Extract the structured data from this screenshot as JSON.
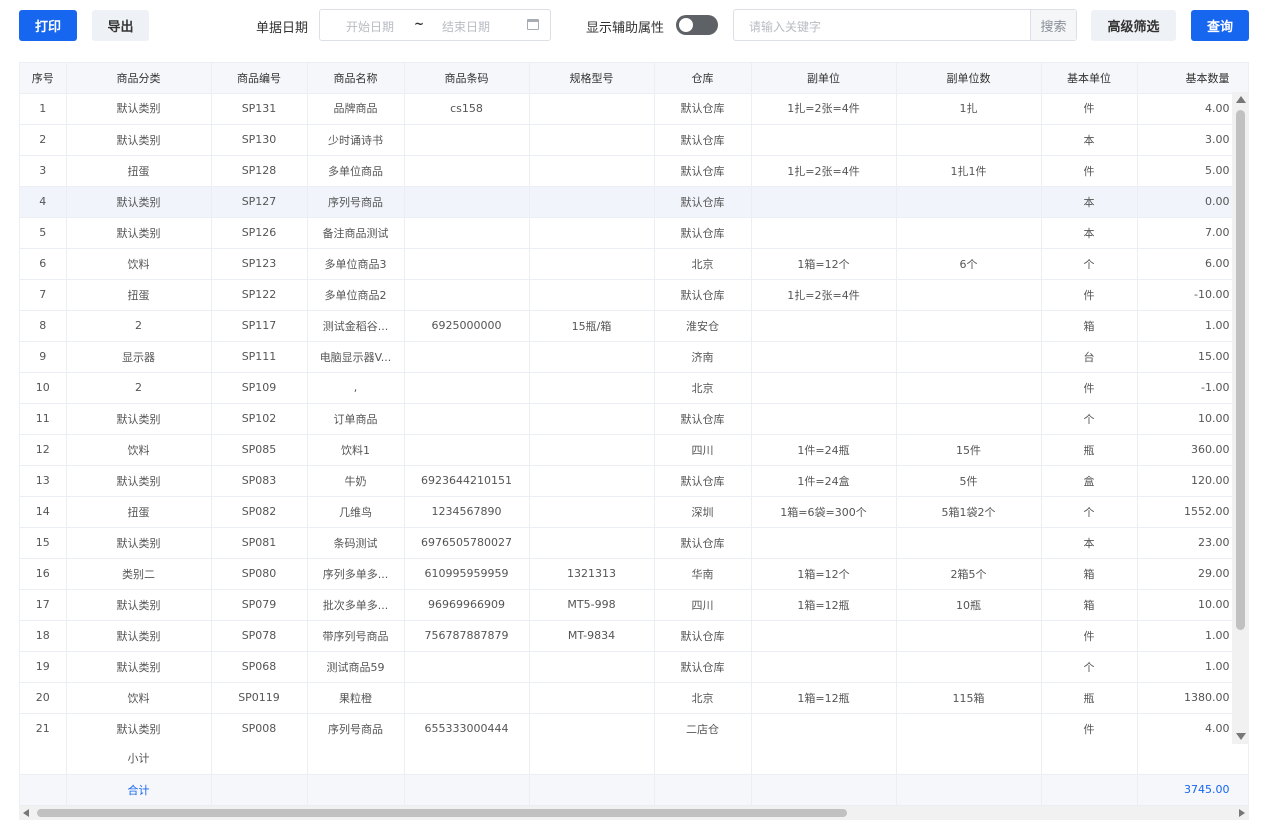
{
  "toolbar": {
    "print_label": "打印",
    "export_label": "导出",
    "date_label": "单据日期",
    "start_date_placeholder": "开始日期",
    "date_separator": "~",
    "end_date_placeholder": "结束日期",
    "aux_toggle_label": "显示辅助属性",
    "aux_toggle_on": false,
    "keyword_placeholder": "请输入关键字",
    "search_label": "搜索",
    "advanced_filter_label": "高级筛选",
    "query_label": "查询"
  },
  "colors": {
    "primary": "#1766f0",
    "header_bg": "#f5f7fa",
    "highlight_row": "#f1f4fb"
  },
  "table": {
    "columns": [
      "序号",
      "商品分类",
      "商品编号",
      "商品名称",
      "商品条码",
      "规格型号",
      "仓库",
      "副单位",
      "副单位数",
      "基本单位",
      "基本数量"
    ],
    "rows": [
      [
        "1",
        "默认类别",
        "SP131",
        "品牌商品",
        "cs158",
        "",
        "默认仓库",
        "1扎=2张=4件",
        "1扎",
        "件",
        "4.00"
      ],
      [
        "2",
        "默认类别",
        "SP130",
        "少时诵诗书",
        "",
        "",
        "默认仓库",
        "",
        "",
        "本",
        "3.00"
      ],
      [
        "3",
        "扭蛋",
        "SP128",
        "多单位商品",
        "",
        "",
        "默认仓库",
        "1扎=2张=4件",
        "1扎1件",
        "件",
        "5.00"
      ],
      [
        "4",
        "默认类别",
        "SP127",
        "序列号商品",
        "",
        "",
        "默认仓库",
        "",
        "",
        "本",
        "0.00"
      ],
      [
        "5",
        "默认类别",
        "SP126",
        "备注商品测试",
        "",
        "",
        "默认仓库",
        "",
        "",
        "本",
        "7.00"
      ],
      [
        "6",
        "饮料",
        "SP123",
        "多单位商品3",
        "",
        "",
        "北京",
        "1箱=12个",
        "6个",
        "个",
        "6.00"
      ],
      [
        "7",
        "扭蛋",
        "SP122",
        "多单位商品2",
        "",
        "",
        "默认仓库",
        "1扎=2张=4件",
        "",
        "件",
        "-10.00"
      ],
      [
        "8",
        "2",
        "SP117",
        "测试金稻谷...",
        "6925000000",
        "15瓶/箱",
        "淮安仓",
        "",
        "",
        "箱",
        "1.00"
      ],
      [
        "9",
        "显示器",
        "SP111",
        "电脑显示器V...",
        "",
        "",
        "济南",
        "",
        "",
        "台",
        "15.00"
      ],
      [
        "10",
        "2",
        "SP109",
        ",",
        "",
        "",
        "北京",
        "",
        "",
        "件",
        "-1.00"
      ],
      [
        "11",
        "默认类别",
        "SP102",
        "订单商品",
        "",
        "",
        "默认仓库",
        "",
        "",
        "个",
        "10.00"
      ],
      [
        "12",
        "饮料",
        "SP085",
        "饮料1",
        "",
        "",
        "四川",
        "1件=24瓶",
        "15件",
        "瓶",
        "360.00"
      ],
      [
        "13",
        "默认类别",
        "SP083",
        "牛奶",
        "6923644210151",
        "",
        "默认仓库",
        "1件=24盒",
        "5件",
        "盒",
        "120.00"
      ],
      [
        "14",
        "扭蛋",
        "SP082",
        "几维鸟",
        "1234567890",
        "",
        "深圳",
        "1箱=6袋=300个",
        "5箱1袋2个",
        "个",
        "1552.00"
      ],
      [
        "15",
        "默认类别",
        "SP081",
        "条码测试",
        "6976505780027",
        "",
        "默认仓库",
        "",
        "",
        "本",
        "23.00"
      ],
      [
        "16",
        "类别二",
        "SP080",
        "序列多单多...",
        "610995959959",
        "1321313",
        "华南",
        "1箱=12个",
        "2箱5个",
        "箱",
        "29.00"
      ],
      [
        "17",
        "默认类别",
        "SP079",
        "批次多单多...",
        "96969966909",
        "MT5-998",
        "四川",
        "1箱=12瓶",
        "10瓶",
        "箱",
        "10.00"
      ],
      [
        "18",
        "默认类别",
        "SP078",
        "带序列号商品",
        "756787887879",
        "MT-9834",
        "默认仓库",
        "",
        "",
        "件",
        "1.00"
      ],
      [
        "19",
        "默认类别",
        "SP068",
        "测试商品59",
        "",
        "",
        "默认仓库",
        "",
        "",
        "个",
        "1.00"
      ],
      [
        "20",
        "饮料",
        "SP0119",
        "果粒橙",
        "",
        "",
        "北京",
        "1箱=12瓶",
        "115箱",
        "瓶",
        "1380.00"
      ],
      [
        "21",
        "默认类别",
        "SP008",
        "序列号商品",
        "655333000444",
        "",
        "二店仓",
        "",
        "",
        "件",
        "4.00"
      ]
    ],
    "subtotal_label": "小计",
    "total_label": "合计",
    "total_quantity": "3745.00"
  }
}
